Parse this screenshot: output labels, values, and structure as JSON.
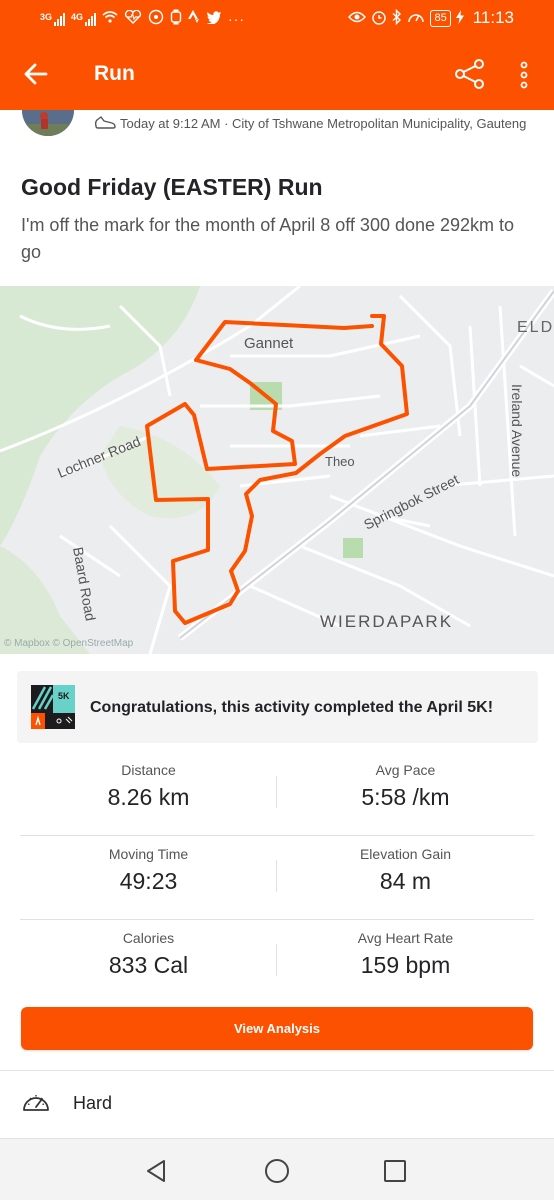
{
  "status_bar": {
    "network_1": "3G",
    "network_2": "4G",
    "battery": "85",
    "time": "11:13"
  },
  "app_bar": {
    "title": "Run"
  },
  "activity": {
    "meta": "Today at 9:12 AM · City of Tshwane Metropolitan Municipality, Gauteng",
    "title": "Good Friday (EASTER) Run",
    "description": "I'm off the mark for the month of April 8 off 300 done 292km to go"
  },
  "map": {
    "labels": {
      "gannet": "Gannet",
      "eld": "ELD",
      "ireland": "Ireland Avenue",
      "lochner": "Lochner Road",
      "theo": "Theo",
      "springbok": "Springbok Street",
      "baard": "Baard Road",
      "wierdapark": "WIERDAPARK"
    },
    "attribution": "© Mapbox © OpenStreetMap",
    "route_color": "#fc5200"
  },
  "achievement": {
    "badge_text": "5K",
    "text": "Congratulations, this activity completed the April 5K!"
  },
  "stats": [
    {
      "left_label": "Distance",
      "left_value": "8.26 km",
      "right_label": "Avg Pace",
      "right_value": "5:58 /km"
    },
    {
      "left_label": "Moving Time",
      "left_value": "49:23",
      "right_label": "Elevation Gain",
      "right_value": "84 m"
    },
    {
      "left_label": "Calories",
      "left_value": "833 Cal",
      "right_label": "Avg Heart Rate",
      "right_value": "159 bpm"
    }
  ],
  "analysis_button": "View Analysis",
  "effort": {
    "label": "Hard"
  },
  "colors": {
    "brand": "#fc5200"
  }
}
